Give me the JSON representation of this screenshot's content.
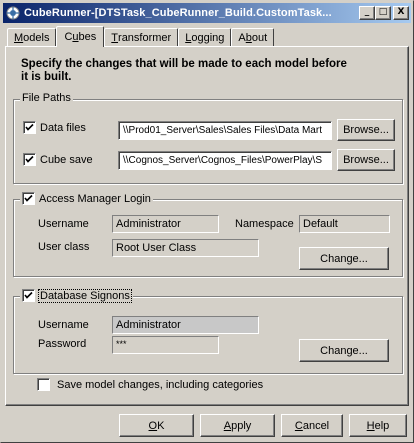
{
  "window": {
    "title": "CubeRunner-[DTSTask_CubeRunner_Build.CustomTask...",
    "buttons": {
      "minimize": "_",
      "maximize": "□",
      "close": "X"
    }
  },
  "tabs": [
    {
      "label": "Models",
      "accel": "M",
      "rest": "odels"
    },
    {
      "label": "Cubes",
      "pre": "C",
      "accel": "u",
      "rest": "bes",
      "active": true
    },
    {
      "label": "Transformer",
      "accel": "T",
      "rest": "ransformer"
    },
    {
      "label": "Logging",
      "accel": "L",
      "rest": "ogging"
    },
    {
      "label": "About",
      "pre": "A",
      "accel": "b",
      "rest": "out"
    }
  ],
  "heading_line1": "Specify the changes that will be made to each model before",
  "heading_line2": "it is built.",
  "file_paths": {
    "group_label": "File Paths",
    "data_files": {
      "label": "Data files",
      "value": "\\\\Prod01_Server\\Sales\\Sales Files\\Data Mart",
      "checked": true,
      "browse": "Browse..."
    },
    "cube_save": {
      "label": "Cube save",
      "value": "\\\\Cognos_Server\\Cognos_Files\\PowerPlay\\S",
      "checked": true,
      "browse": "Browse..."
    }
  },
  "access_manager": {
    "group_label": "Access Manager Login",
    "checked": true,
    "username_label": "Username",
    "username": "Administrator",
    "namespace_label": "Namespace",
    "namespace": "Default",
    "userclass_label": "User class",
    "userclass": "Root User Class",
    "change": "Change..."
  },
  "database_signons": {
    "group_label": "Database Signons",
    "checked": true,
    "username_label": "Username",
    "username": "Administrator",
    "password_label": "Password",
    "password": "***",
    "change": "Change..."
  },
  "save_model": {
    "label": "Save model changes, including categories",
    "checked": false
  },
  "footer": {
    "ok": {
      "accel": "O",
      "rest": "K"
    },
    "apply": {
      "accel": "A",
      "rest": "pply"
    },
    "cancel": {
      "accel": "C",
      "rest": "ancel"
    },
    "help": {
      "accel": "H",
      "rest": "elp"
    }
  },
  "colors": {
    "title_start": "#0a246a",
    "title_end": "#a6caf0",
    "face": "#d4d0c8"
  }
}
